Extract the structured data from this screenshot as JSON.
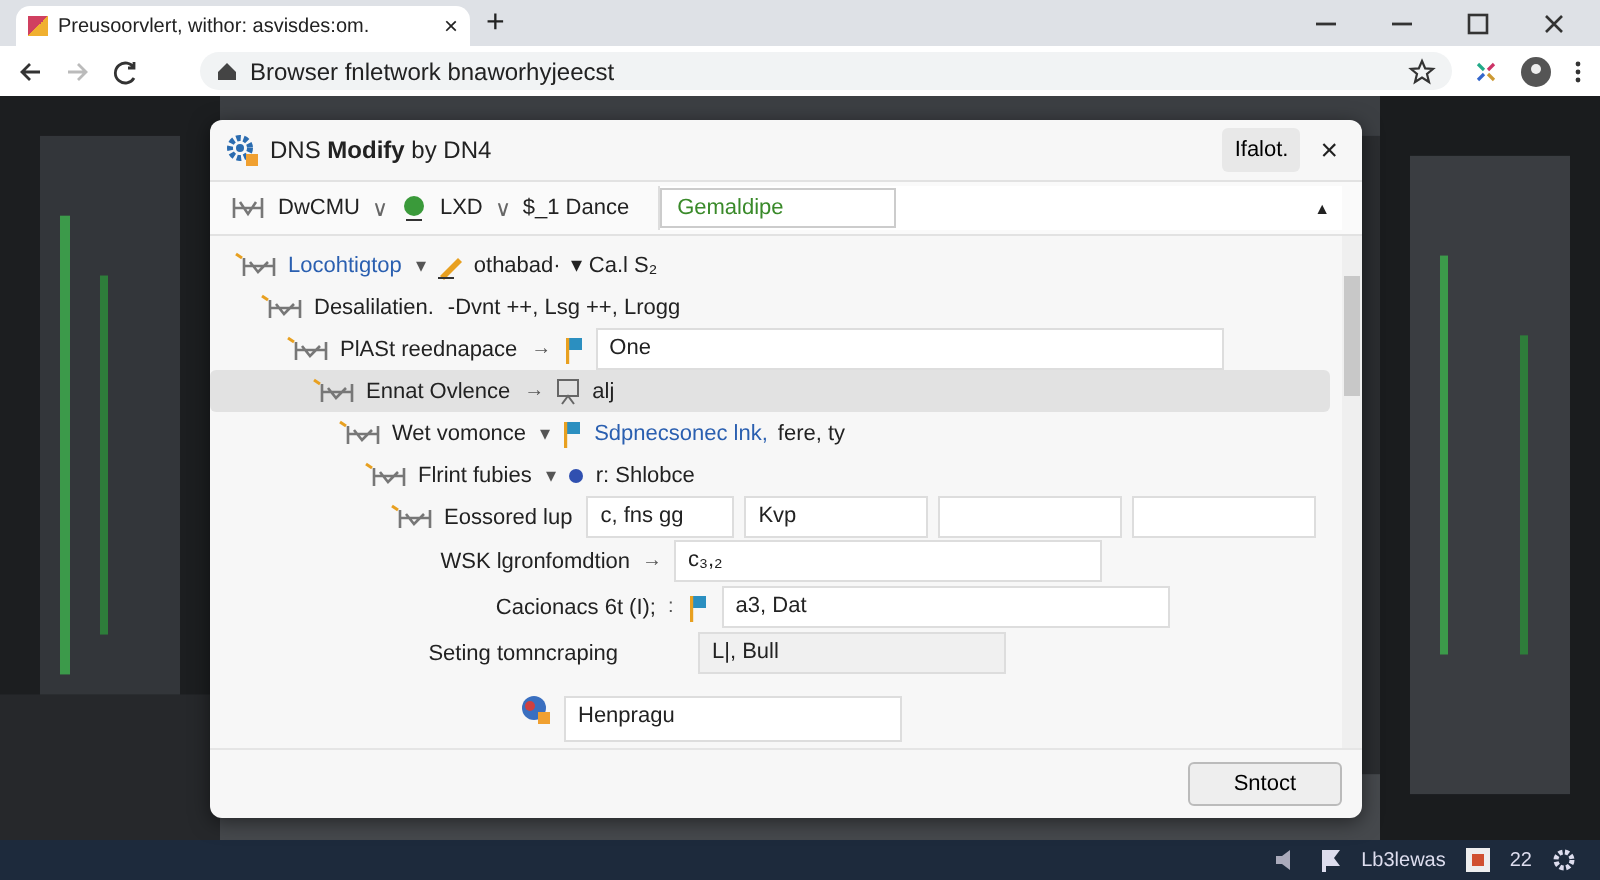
{
  "browser": {
    "tab_title": "Preusoorvlert, withor: asvisdes:om.",
    "tab_close": "×",
    "new_tab": "+",
    "address": "Browser fnletwork bnaworhyjeecst"
  },
  "dialog": {
    "title": "DNS **Modify** by DN4",
    "header_button": "Ifalot.",
    "close": "×",
    "toolbar": [
      {
        "kind": "menu",
        "label": "DwCMU",
        "caret": "∨"
      },
      {
        "kind": "menu",
        "label": "LXD",
        "caret": "∨"
      },
      {
        "kind": "text",
        "label": "$_1 Dance"
      }
    ],
    "toolbar_field": "Gemaldipe",
    "toolbar_arrow": "▲",
    "tree": [
      {
        "label": "Locohtigtop",
        "kind": "link",
        "toggle": "▾",
        "values": [
          "othabad·",
          "▾ Ca.l S₂"
        ],
        "selected": false,
        "children": [
          {
            "label": "Desalilatien.",
            "kind": "text",
            "values": [
              "-Dvnt ++, Lsg ++, Lrogg"
            ],
            "selected": false,
            "children": [
              {
                "label": "PlASt reednapace",
                "kind": "text",
                "toggle": "→",
                "field": "One",
                "selected": false,
                "children": [
                  {
                    "label": "Ennat Ovlence",
                    "kind": "text",
                    "toggle": "→",
                    "values": [
                      "alj"
                    ],
                    "selected": true,
                    "children": [
                      {
                        "label": "Wet vomonce",
                        "kind": "text",
                        "toggle": "▾",
                        "link": "Sdpnecsonec lnk,",
                        "values": [
                          "fere, ty"
                        ],
                        "selected": false,
                        "children": [
                          {
                            "label": "Flrint fubies",
                            "kind": "text",
                            "toggle": "▾",
                            "values": [
                              "r: Shlobce"
                            ],
                            "selected": false,
                            "children": [
                              {
                                "label": "Eossored lup",
                                "kind": "fields",
                                "fields": [
                                  "c, fns gg",
                                  "Kvp"
                                ],
                                "selected": false
                              }
                            ]
                          }
                        ]
                      }
                    ]
                  }
                ]
              }
            ]
          }
        ]
      }
    ],
    "form": [
      {
        "kind": "arrow-field",
        "label": "WSK lgronfomdtion",
        "toggle": "→",
        "field": "c₃,₂"
      },
      {
        "kind": "flag-field",
        "label": "Cacionacs 6t  (I);",
        "toggle": ":",
        "field": "a3, Dat"
      },
      {
        "kind": "grey-field",
        "label": "Seting tomncraping",
        "field": "L|, Bull"
      },
      {
        "kind": "icon-field",
        "field": "Henpragu"
      }
    ],
    "footer_button": "Sntoct"
  },
  "taskbar": {
    "app": "Lb3lewas",
    "clock": "22"
  }
}
